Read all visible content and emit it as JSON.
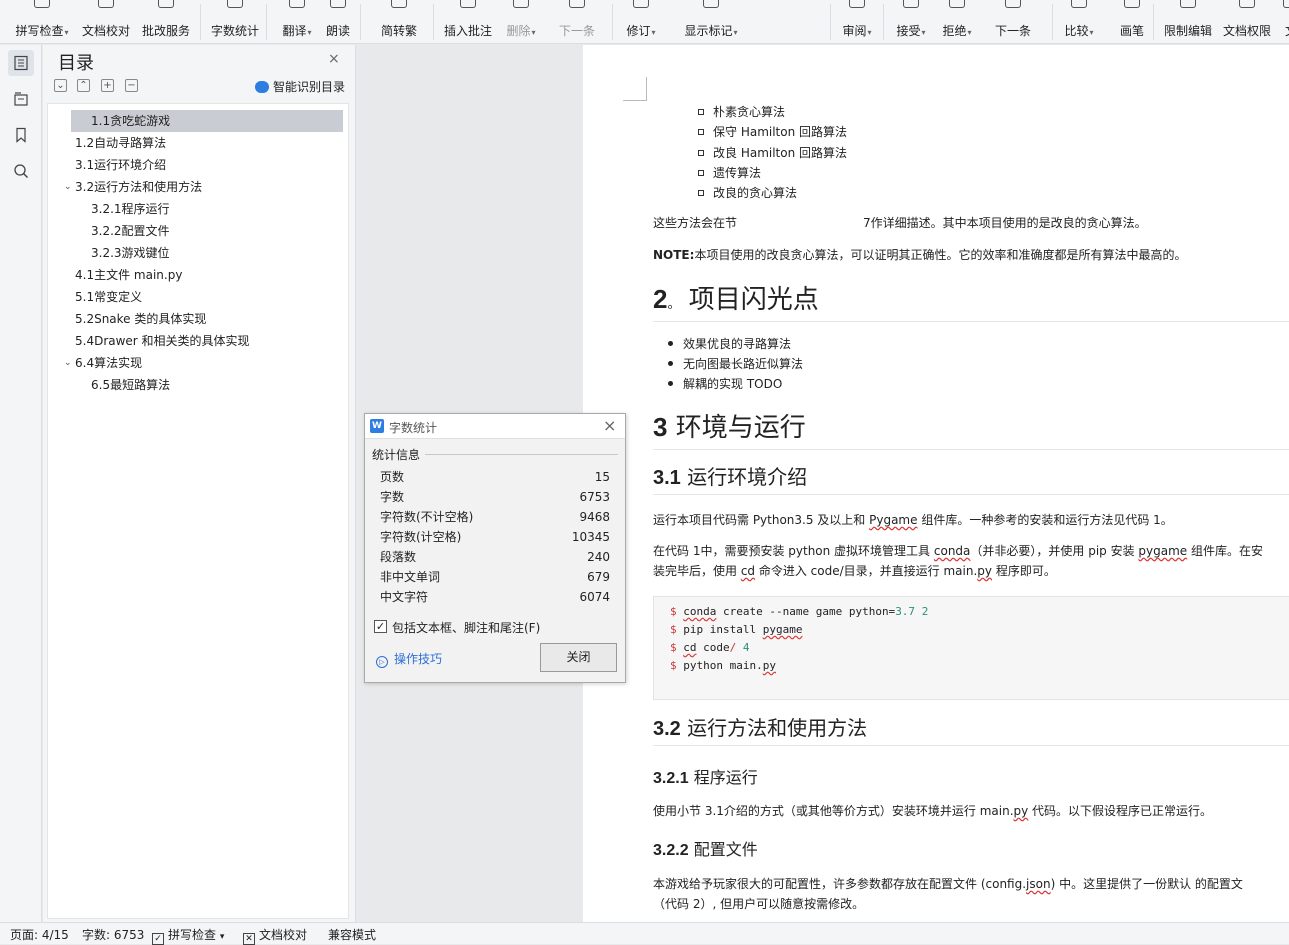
{
  "ribbon": {
    "buttons": [
      {
        "label": "拼写检查",
        "caret": true
      },
      {
        "label": "文档校对",
        "caret": false
      },
      {
        "label": "批改服务",
        "caret": false
      },
      {
        "label": "字数统计",
        "caret": false
      },
      {
        "label": "翻译",
        "caret": true
      },
      {
        "label": "朗读",
        "caret": false
      },
      {
        "label": "简转繁",
        "caret": false
      },
      {
        "label": "插入批注",
        "caret": false
      },
      {
        "label": "删除",
        "caret": true
      },
      {
        "label": "下一条",
        "caret": false
      },
      {
        "label": "修订",
        "caret": true
      },
      {
        "label": "显示标记",
        "caret": true
      },
      {
        "label": "审阅",
        "caret": true
      },
      {
        "label": "接受",
        "caret": true
      },
      {
        "label": "拒绝",
        "caret": true
      },
      {
        "label": "下一条",
        "caret": false
      },
      {
        "label": "比较",
        "caret": true
      },
      {
        "label": "画笔",
        "caret": false
      },
      {
        "label": "限制编辑",
        "caret": false
      },
      {
        "label": "文档权限",
        "caret": false
      },
      {
        "label": "文",
        "caret": false
      }
    ]
  },
  "toc": {
    "title": "目录",
    "close": "×",
    "tool_expand": "⌄",
    "tool_collapse": "⌃",
    "tool_add": "+",
    "tool_remove": "−",
    "smart_label": "智能识别目录",
    "chevron": "⌄",
    "items": [
      {
        "label": "1.1贪吃蛇游戏"
      },
      {
        "label": "1.2自动寻路算法"
      },
      {
        "label": "3.1运行环境介绍"
      },
      {
        "label": "3.2运行方法和使用方法"
      },
      {
        "label": "3.2.1程序运行"
      },
      {
        "label": "3.2.2配置文件"
      },
      {
        "label": "3.2.3游戏键位"
      },
      {
        "label": "4.1主文件 main.py"
      },
      {
        "label": "5.1常变定义"
      },
      {
        "label": "5.2Snake 类的具体实现"
      },
      {
        "label": "5.4Drawer 和相关类的具体实现"
      },
      {
        "label": "6.4算法实现"
      },
      {
        "label": "6.5最短路算法"
      }
    ]
  },
  "doc": {
    "bullets_sq": [
      "朴素贪心算法",
      "保守 Hamilton 回路算法",
      "改良 Hamilton 回路算法",
      "遗传算法",
      "改良的贪心算法"
    ],
    "methods_a": "这些方法会在节",
    "methods_b": "7作详细描述。其中本项目使用的是改良的贪心算法。",
    "note_label": "NOTE:",
    "note_text": "本项目使用的改良贪心算法，可以证明其正确性。它的效率和准确度都是所有算法中最高的。",
    "h_2_num": "2",
    "h_2_dot": "。",
    "h_2_text": "项目闪光点",
    "bullets_dot": [
      "效果优良的寻路算法",
      "无向图最长路近似算法",
      "解耦的实现 TODO"
    ],
    "h_3_num": "3",
    "h_3_text": "环境与运行",
    "h_31_num": "3.1",
    "h_31_text": "运行环境介绍",
    "p1_a": "运行本项目代码需 Python3.5 及以上和 ",
    "p1_w": "Pygame",
    "p1_b": " 组件库。一种参考的安装和运行方法见代码 1。",
    "p2_a": "在代码 1中，需要预安装 python 虚拟环境管理工具 ",
    "p2_w1": "conda",
    "p2_b": "（并非必要），并使用 pip 安装 ",
    "p2_w2": "pygame",
    "p2_c": " 组件库。在安",
    "p3_a": "装完毕后，使用 ",
    "p3_w": "cd",
    "p3_b": " 命令进入 code/目录，并直接运行 main.",
    "p3_w2": "py",
    "p3_c": " 程序即可。",
    "code_dollar": "$",
    "code_l1_a": "conda",
    "code_l1_b": " create --name game python=",
    "code_l1_num": "3.7",
    "code_l1_ln": "2",
    "code_l2_a": "pip install ",
    "code_l2_w": "pygame",
    "code_l3_a": "cd",
    "code_l3_b": " code",
    "code_l3_slash": "/",
    "code_l3_ln": "4",
    "code_l4_a": "python main.",
    "code_l4_w": "py",
    "h_32_num": "3.2",
    "h_32_text": "运行方法和使用方法",
    "h_321_num": "3.2.1",
    "h_321_text": "程序运行",
    "p4_a": "使用小节 3.1介绍的方式（或其他等价方式）安装环境并运行 main.",
    "p4_w": "py",
    "p4_b": " 代码。以下假设程序已正常运行。",
    "h_322_num": "3.2.2",
    "h_322_text": "配置文件",
    "p5_a": "本游戏给予玩家很大的可配置性，许多参数都存放在配置文件 (config.",
    "p5_w": "json",
    "p5_b": ") 中。这里提供了一份默认 的配置文",
    "p6": "（代码 2）, 但用户可以随意按需修改。"
  },
  "dialog": {
    "logo": "W",
    "title": "字数统计",
    "close_x": "×",
    "section": "统计信息",
    "rows": [
      {
        "label": "页数",
        "value": "15"
      },
      {
        "label": "字数",
        "value": "6753"
      },
      {
        "label": "字符数(不计空格)",
        "value": "9468"
      },
      {
        "label": "字符数(计空格)",
        "value": "10345"
      },
      {
        "label": "段落数",
        "value": "240"
      },
      {
        "label": "非中文单词",
        "value": "679"
      },
      {
        "label": "中文字符",
        "value": "6074"
      }
    ],
    "checkbox_mark": "✓",
    "checkbox_label": "包括文本框、脚注和尾注(F)",
    "tips_icon": "▷",
    "tips": "操作技巧",
    "close_button": "关闭"
  },
  "status": {
    "page": "页面: 4/15",
    "words": "字数: 6753",
    "spell_icon": "✓",
    "spell": "拼写检查",
    "spell_caret": "▾",
    "proof_icon": "✕",
    "proof": "文档校对",
    "compat": "兼容模式"
  }
}
